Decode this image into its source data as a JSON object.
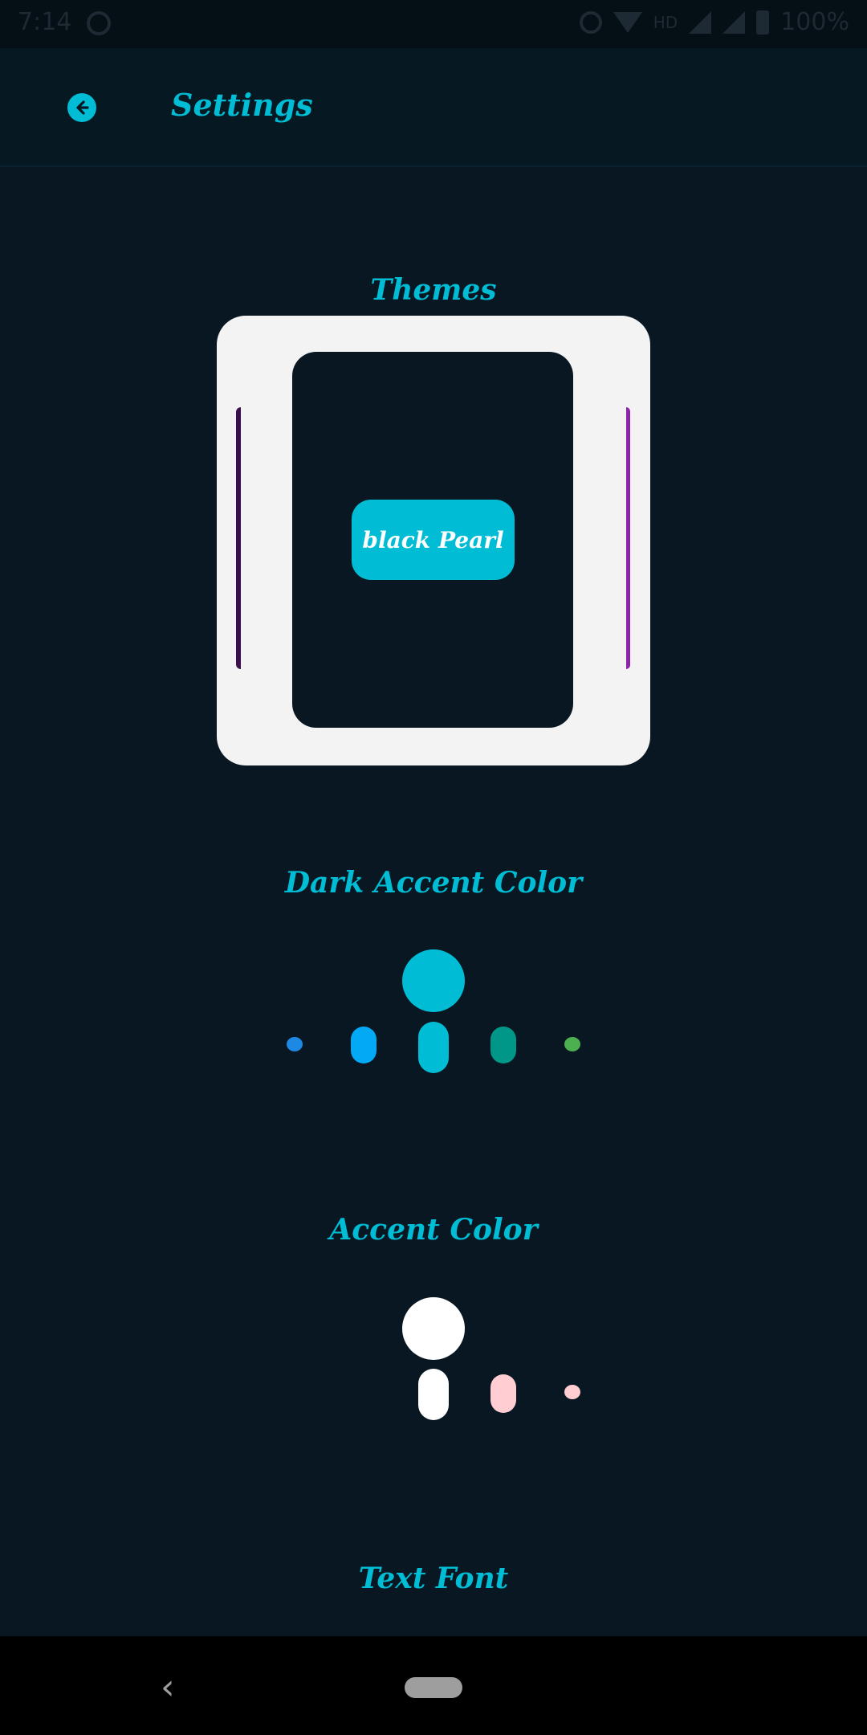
{
  "status_bar": {
    "time": "7:14",
    "network": "HD",
    "battery": "100%"
  },
  "header": {
    "title": "Settings",
    "back_icon": "arrow-left-circle-icon"
  },
  "themes": {
    "title": "Themes",
    "selected_label": "black Pearl",
    "left_edge_color": "#3b0f4c",
    "right_edge_color": "#8e24aa"
  },
  "dark_accent": {
    "title": "Dark Accent Color",
    "selected_color": "#00bcd4",
    "options": [
      "#1e88e5",
      "#03a9f4",
      "#00bcd4",
      "#009688",
      "#4caf50"
    ]
  },
  "accent": {
    "title": "Accent Color",
    "selected_color": "#ffffff",
    "options": [
      "#ffffff",
      "#ffcdd2",
      "#ffcdd2"
    ]
  },
  "text_font": {
    "title": "Text Font"
  },
  "colors": {
    "background": "#081721",
    "accent": "#00bcd4"
  }
}
